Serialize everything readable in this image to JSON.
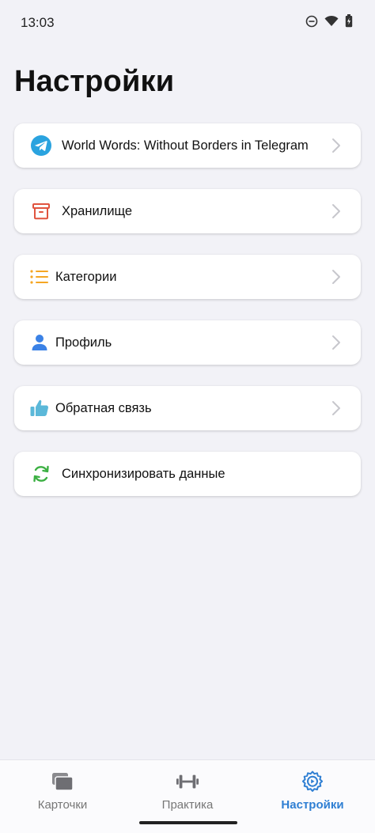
{
  "status_bar": {
    "time": "13:03",
    "icons": [
      "do-not-disturb-icon",
      "wifi-icon",
      "battery-icon"
    ]
  },
  "page": {
    "title": "Настройки"
  },
  "menu": {
    "items": [
      {
        "label": "World Words: Without Borders in Telegram",
        "icon": "telegram-icon",
        "has_chevron": true
      },
      {
        "label": "Хранилище",
        "icon": "archive-icon",
        "has_chevron": true
      },
      {
        "label": "Категории",
        "icon": "list-icon",
        "has_chevron": true
      },
      {
        "label": "Профиль",
        "icon": "person-icon",
        "has_chevron": true
      },
      {
        "label": "Обратная связь",
        "icon": "thumbs-up-icon",
        "has_chevron": true
      },
      {
        "label": "Синхронизировать данные",
        "icon": "sync-icon",
        "has_chevron": false
      }
    ]
  },
  "bottom_nav": {
    "tabs": [
      {
        "label": "Карточки",
        "icon": "cards-icon",
        "active": false
      },
      {
        "label": "Практика",
        "icon": "dumbbell-icon",
        "active": false
      },
      {
        "label": "Настройки",
        "icon": "settings-icon",
        "active": true
      }
    ]
  },
  "colors": {
    "background": "#f2f2f7",
    "accent": "#2f7fd3",
    "telegram": "#2aa3df",
    "archive": "#e0543f",
    "list": "#f5a623",
    "person": "#3b82e6",
    "thumbs_up": "#5bb8d9",
    "sync": "#3cb043"
  }
}
